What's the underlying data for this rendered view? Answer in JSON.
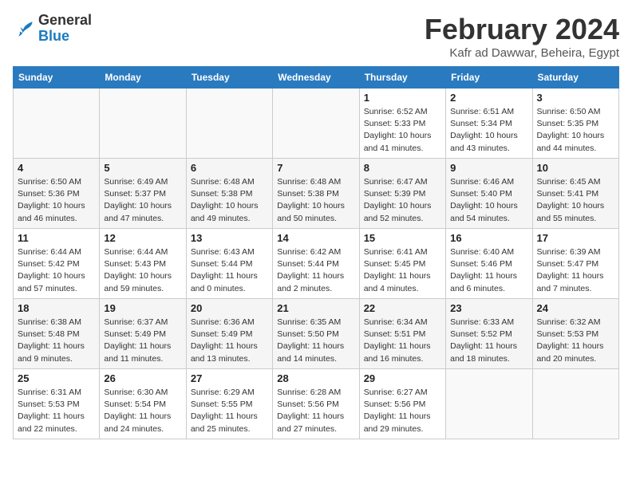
{
  "header": {
    "logo_general": "General",
    "logo_blue": "Blue",
    "month_title": "February 2024",
    "location": "Kafr ad Dawwar, Beheira, Egypt"
  },
  "days_of_week": [
    "Sunday",
    "Monday",
    "Tuesday",
    "Wednesday",
    "Thursday",
    "Friday",
    "Saturday"
  ],
  "weeks": [
    [
      {
        "day": "",
        "sunrise": "",
        "sunset": "",
        "daylight": "",
        "empty": true
      },
      {
        "day": "",
        "sunrise": "",
        "sunset": "",
        "daylight": "",
        "empty": true
      },
      {
        "day": "",
        "sunrise": "",
        "sunset": "",
        "daylight": "",
        "empty": true
      },
      {
        "day": "",
        "sunrise": "",
        "sunset": "",
        "daylight": "",
        "empty": true
      },
      {
        "day": "1",
        "sunrise": "Sunrise: 6:52 AM",
        "sunset": "Sunset: 5:33 PM",
        "daylight": "Daylight: 10 hours and 41 minutes.",
        "empty": false
      },
      {
        "day": "2",
        "sunrise": "Sunrise: 6:51 AM",
        "sunset": "Sunset: 5:34 PM",
        "daylight": "Daylight: 10 hours and 43 minutes.",
        "empty": false
      },
      {
        "day": "3",
        "sunrise": "Sunrise: 6:50 AM",
        "sunset": "Sunset: 5:35 PM",
        "daylight": "Daylight: 10 hours and 44 minutes.",
        "empty": false
      }
    ],
    [
      {
        "day": "4",
        "sunrise": "Sunrise: 6:50 AM",
        "sunset": "Sunset: 5:36 PM",
        "daylight": "Daylight: 10 hours and 46 minutes.",
        "empty": false
      },
      {
        "day": "5",
        "sunrise": "Sunrise: 6:49 AM",
        "sunset": "Sunset: 5:37 PM",
        "daylight": "Daylight: 10 hours and 47 minutes.",
        "empty": false
      },
      {
        "day": "6",
        "sunrise": "Sunrise: 6:48 AM",
        "sunset": "Sunset: 5:38 PM",
        "daylight": "Daylight: 10 hours and 49 minutes.",
        "empty": false
      },
      {
        "day": "7",
        "sunrise": "Sunrise: 6:48 AM",
        "sunset": "Sunset: 5:38 PM",
        "daylight": "Daylight: 10 hours and 50 minutes.",
        "empty": false
      },
      {
        "day": "8",
        "sunrise": "Sunrise: 6:47 AM",
        "sunset": "Sunset: 5:39 PM",
        "daylight": "Daylight: 10 hours and 52 minutes.",
        "empty": false
      },
      {
        "day": "9",
        "sunrise": "Sunrise: 6:46 AM",
        "sunset": "Sunset: 5:40 PM",
        "daylight": "Daylight: 10 hours and 54 minutes.",
        "empty": false
      },
      {
        "day": "10",
        "sunrise": "Sunrise: 6:45 AM",
        "sunset": "Sunset: 5:41 PM",
        "daylight": "Daylight: 10 hours and 55 minutes.",
        "empty": false
      }
    ],
    [
      {
        "day": "11",
        "sunrise": "Sunrise: 6:44 AM",
        "sunset": "Sunset: 5:42 PM",
        "daylight": "Daylight: 10 hours and 57 minutes.",
        "empty": false
      },
      {
        "day": "12",
        "sunrise": "Sunrise: 6:44 AM",
        "sunset": "Sunset: 5:43 PM",
        "daylight": "Daylight: 10 hours and 59 minutes.",
        "empty": false
      },
      {
        "day": "13",
        "sunrise": "Sunrise: 6:43 AM",
        "sunset": "Sunset: 5:44 PM",
        "daylight": "Daylight: 11 hours and 0 minutes.",
        "empty": false
      },
      {
        "day": "14",
        "sunrise": "Sunrise: 6:42 AM",
        "sunset": "Sunset: 5:44 PM",
        "daylight": "Daylight: 11 hours and 2 minutes.",
        "empty": false
      },
      {
        "day": "15",
        "sunrise": "Sunrise: 6:41 AM",
        "sunset": "Sunset: 5:45 PM",
        "daylight": "Daylight: 11 hours and 4 minutes.",
        "empty": false
      },
      {
        "day": "16",
        "sunrise": "Sunrise: 6:40 AM",
        "sunset": "Sunset: 5:46 PM",
        "daylight": "Daylight: 11 hours and 6 minutes.",
        "empty": false
      },
      {
        "day": "17",
        "sunrise": "Sunrise: 6:39 AM",
        "sunset": "Sunset: 5:47 PM",
        "daylight": "Daylight: 11 hours and 7 minutes.",
        "empty": false
      }
    ],
    [
      {
        "day": "18",
        "sunrise": "Sunrise: 6:38 AM",
        "sunset": "Sunset: 5:48 PM",
        "daylight": "Daylight: 11 hours and 9 minutes.",
        "empty": false
      },
      {
        "day": "19",
        "sunrise": "Sunrise: 6:37 AM",
        "sunset": "Sunset: 5:49 PM",
        "daylight": "Daylight: 11 hours and 11 minutes.",
        "empty": false
      },
      {
        "day": "20",
        "sunrise": "Sunrise: 6:36 AM",
        "sunset": "Sunset: 5:49 PM",
        "daylight": "Daylight: 11 hours and 13 minutes.",
        "empty": false
      },
      {
        "day": "21",
        "sunrise": "Sunrise: 6:35 AM",
        "sunset": "Sunset: 5:50 PM",
        "daylight": "Daylight: 11 hours and 14 minutes.",
        "empty": false
      },
      {
        "day": "22",
        "sunrise": "Sunrise: 6:34 AM",
        "sunset": "Sunset: 5:51 PM",
        "daylight": "Daylight: 11 hours and 16 minutes.",
        "empty": false
      },
      {
        "day": "23",
        "sunrise": "Sunrise: 6:33 AM",
        "sunset": "Sunset: 5:52 PM",
        "daylight": "Daylight: 11 hours and 18 minutes.",
        "empty": false
      },
      {
        "day": "24",
        "sunrise": "Sunrise: 6:32 AM",
        "sunset": "Sunset: 5:53 PM",
        "daylight": "Daylight: 11 hours and 20 minutes.",
        "empty": false
      }
    ],
    [
      {
        "day": "25",
        "sunrise": "Sunrise: 6:31 AM",
        "sunset": "Sunset: 5:53 PM",
        "daylight": "Daylight: 11 hours and 22 minutes.",
        "empty": false
      },
      {
        "day": "26",
        "sunrise": "Sunrise: 6:30 AM",
        "sunset": "Sunset: 5:54 PM",
        "daylight": "Daylight: 11 hours and 24 minutes.",
        "empty": false
      },
      {
        "day": "27",
        "sunrise": "Sunrise: 6:29 AM",
        "sunset": "Sunset: 5:55 PM",
        "daylight": "Daylight: 11 hours and 25 minutes.",
        "empty": false
      },
      {
        "day": "28",
        "sunrise": "Sunrise: 6:28 AM",
        "sunset": "Sunset: 5:56 PM",
        "daylight": "Daylight: 11 hours and 27 minutes.",
        "empty": false
      },
      {
        "day": "29",
        "sunrise": "Sunrise: 6:27 AM",
        "sunset": "Sunset: 5:56 PM",
        "daylight": "Daylight: 11 hours and 29 minutes.",
        "empty": false
      },
      {
        "day": "",
        "sunrise": "",
        "sunset": "",
        "daylight": "",
        "empty": true
      },
      {
        "day": "",
        "sunrise": "",
        "sunset": "",
        "daylight": "",
        "empty": true
      }
    ]
  ]
}
